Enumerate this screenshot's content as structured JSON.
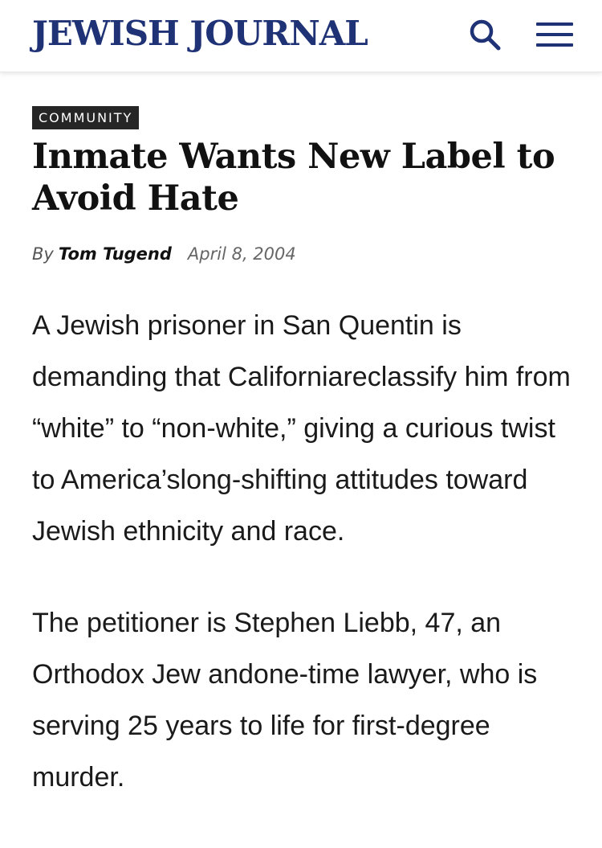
{
  "header": {
    "logo": "JEWISH JOURNAL",
    "search_icon": "search-icon",
    "menu_icon": "hamburger-menu-icon",
    "brand_color": "#1f3276"
  },
  "article": {
    "category": "COMMUNITY",
    "headline": "Inmate Wants New Label to Avoid Hate",
    "byline_prefix": "By",
    "author": "Tom Tugend",
    "date": "April 8, 2004",
    "paragraphs": [
      "A Jewish prisoner in San Quentin is demanding that Californiareclassify him from “white” to “non-white,” giving a curious twist to America’slong-shifting attitudes toward Jewish ethnicity and race.",
      "The petitioner is Stephen Liebb, 47, an Orthodox Jew andone-time lawyer, who is serving 25 years to life for first-degree murder."
    ]
  }
}
